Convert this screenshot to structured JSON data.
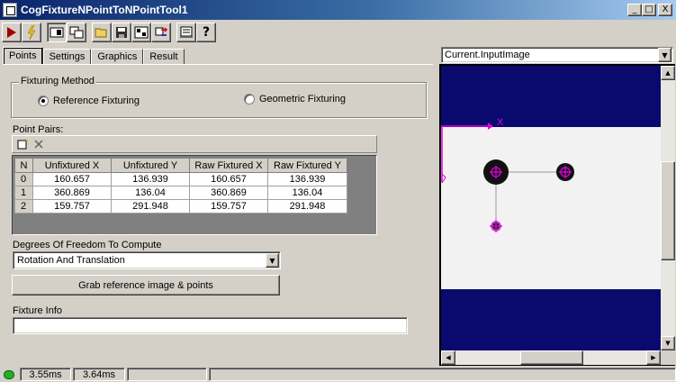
{
  "window": {
    "title": "CogFixtureNPointToNPointTool1",
    "minimize": "_",
    "maximize": "□",
    "close": "X"
  },
  "toolbar": {
    "buttons": [
      {
        "name": "run-icon",
        "glyph": "▶"
      },
      {
        "name": "electric-icon",
        "glyph": "⚡"
      },
      {
        "name": "show-hide-icon",
        "glyph": "▭"
      },
      {
        "name": "local-display-icon",
        "glyph": "⧉"
      },
      {
        "name": "open-icon",
        "glyph": "📂"
      },
      {
        "name": "save-icon",
        "glyph": "💾"
      },
      {
        "name": "image-source-icon",
        "glyph": "▦"
      },
      {
        "name": "reset-icon",
        "glyph": "⇄"
      },
      {
        "name": "report-icon",
        "glyph": "▤"
      },
      {
        "name": "help-icon",
        "glyph": "?"
      }
    ]
  },
  "tabs": [
    "Points",
    "Settings",
    "Graphics",
    "Result"
  ],
  "fixturing": {
    "group_label": "Fixturing Method",
    "options": [
      "Reference Fixturing",
      "Geometric Fixturing"
    ],
    "selected": "Reference Fixturing"
  },
  "point_pairs": {
    "label": "Point Pairs:",
    "columns": [
      "N",
      "Unfixtured X",
      "Unfixtured Y",
      "Raw Fixtured X",
      "Raw Fixtured Y"
    ],
    "rows": [
      [
        "0",
        "160.657",
        "136.939",
        "160.657",
        "136.939"
      ],
      [
        "1",
        "360.869",
        "136.04",
        "360.869",
        "136.04"
      ],
      [
        "2",
        "159.757",
        "291.948",
        "159.757",
        "291.948"
      ]
    ]
  },
  "dof": {
    "label": "Degrees Of Freedom To Compute",
    "value": "Rotation And Translation"
  },
  "grab_button": "Grab reference image & points",
  "fixture_info": {
    "label": "Fixture Info",
    "value": ""
  },
  "viewer": {
    "selected": "Current.InputImage",
    "axis_label": "X",
    "background_color": "#0a0a6e",
    "image_color": "#f2f2f2",
    "marker_color": "#e000e0"
  },
  "status": {
    "time1": "3.55ms",
    "time2": "3.64ms"
  }
}
